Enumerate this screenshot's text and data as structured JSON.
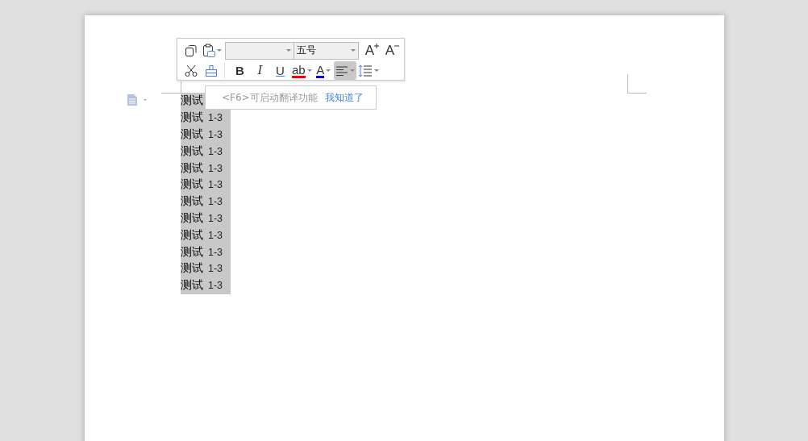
{
  "toolbar": {
    "row1": [
      {
        "kind": "copy",
        "dropdown": false,
        "selected": false
      },
      {
        "kind": "paste",
        "dropdown": true,
        "selected": false
      },
      {
        "kind": "font-name",
        "dropdown": true,
        "selected": false
      },
      {
        "kind": "font-size",
        "value": "五号",
        "dropdown": true,
        "selected": false
      },
      {
        "kind": "grow",
        "label": "A",
        "dropdown": false,
        "selected": false
      },
      {
        "kind": "shrink",
        "label": "A",
        "dropdown": false,
        "selected": false
      }
    ],
    "row2": [
      {
        "kind": "cut",
        "dropdown": false,
        "selected": false
      },
      {
        "kind": "painter",
        "dropdown": false,
        "selected": false
      },
      {
        "kind": "bold",
        "label": "B",
        "dropdown": false,
        "selected": false
      },
      {
        "kind": "italic",
        "label": "I",
        "dropdown": false,
        "selected": false
      },
      {
        "kind": "underline",
        "label": "U",
        "dropdown": false,
        "selected": false
      },
      {
        "kind": "highlight",
        "label": "ab",
        "color": "#ff0000",
        "dropdown": true,
        "selected": false
      },
      {
        "kind": "font-color",
        "label": "A",
        "color": "#0000ff",
        "dropdown": true,
        "selected": false
      },
      {
        "kind": "align",
        "dropdown": true,
        "selected": true
      },
      {
        "kind": "spacing",
        "dropdown": true,
        "selected": false
      }
    ]
  },
  "tooltip": {
    "hint": "<F6>可启动翻译功能",
    "link": "我知道了"
  },
  "lines": [
    {
      "text": "测试",
      "selected": true
    },
    {
      "text": "测试",
      "number": "1-3",
      "selected": true
    },
    {
      "text": "测试",
      "number": "1-3",
      "selected": true
    },
    {
      "text": "测试",
      "number": "1-3",
      "selected": true
    },
    {
      "text": "测试",
      "number": "1-3",
      "selected": true
    },
    {
      "text": "测试",
      "number": "1-3",
      "selected": true
    },
    {
      "text": "测试",
      "number": "1-3",
      "selected": true
    },
    {
      "text": "测试",
      "number": "1-3",
      "selected": true
    },
    {
      "text": "测试",
      "number": "1-3",
      "selected": true
    },
    {
      "text": "测试",
      "number": "1-3",
      "selected": true
    },
    {
      "text": "测试",
      "number": "1-3",
      "selected": true
    },
    {
      "text": "测试",
      "number": "1-3",
      "selected": true
    }
  ]
}
